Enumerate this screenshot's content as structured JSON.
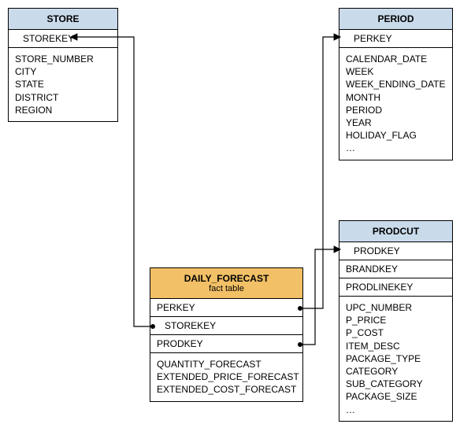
{
  "diagram_type": "star-schema",
  "entities": {
    "store": {
      "title": "STORE",
      "key": "STOREKEY",
      "attrs": [
        "STORE_NUMBER",
        "CITY",
        "STATE",
        "DISTRICT",
        "REGION"
      ]
    },
    "period": {
      "title": "PERIOD",
      "key": "PERKEY",
      "attrs": [
        "CALENDAR_DATE",
        "WEEK",
        "WEEK_ENDING_DATE",
        "MONTH",
        "PERIOD",
        "YEAR",
        "HOLIDAY_FLAG",
        "…"
      ]
    },
    "product": {
      "title": "PRODCUT",
      "key": "PRODKEY",
      "key2": "BRANDKEY",
      "key3": "PRODLINEKEY",
      "attrs": [
        "UPC_NUMBER",
        "P_PRICE",
        "P_COST",
        "ITEM_DESC",
        "PACKAGE_TYPE",
        "CATEGORY",
        "SUB_CATEGORY",
        "PACKAGE_SIZE",
        "…"
      ]
    },
    "fact": {
      "title": "DAILY_FORECAST",
      "subtitle": "fact table",
      "fk1": "PERKEY",
      "fk2": "STOREKEY",
      "fk3": "PRODKEY",
      "measures": [
        "QUANTITY_FORECAST",
        "EXTENDED_PRICE_FORECAST",
        "EXTENDED_COST_FORECAST"
      ]
    }
  },
  "relationships": [
    {
      "from": "fact.PERKEY",
      "to": "period.PERKEY"
    },
    {
      "from": "fact.STOREKEY",
      "to": "store.STOREKEY"
    },
    {
      "from": "fact.PRODKEY",
      "to": "product.PRODKEY"
    }
  ]
}
